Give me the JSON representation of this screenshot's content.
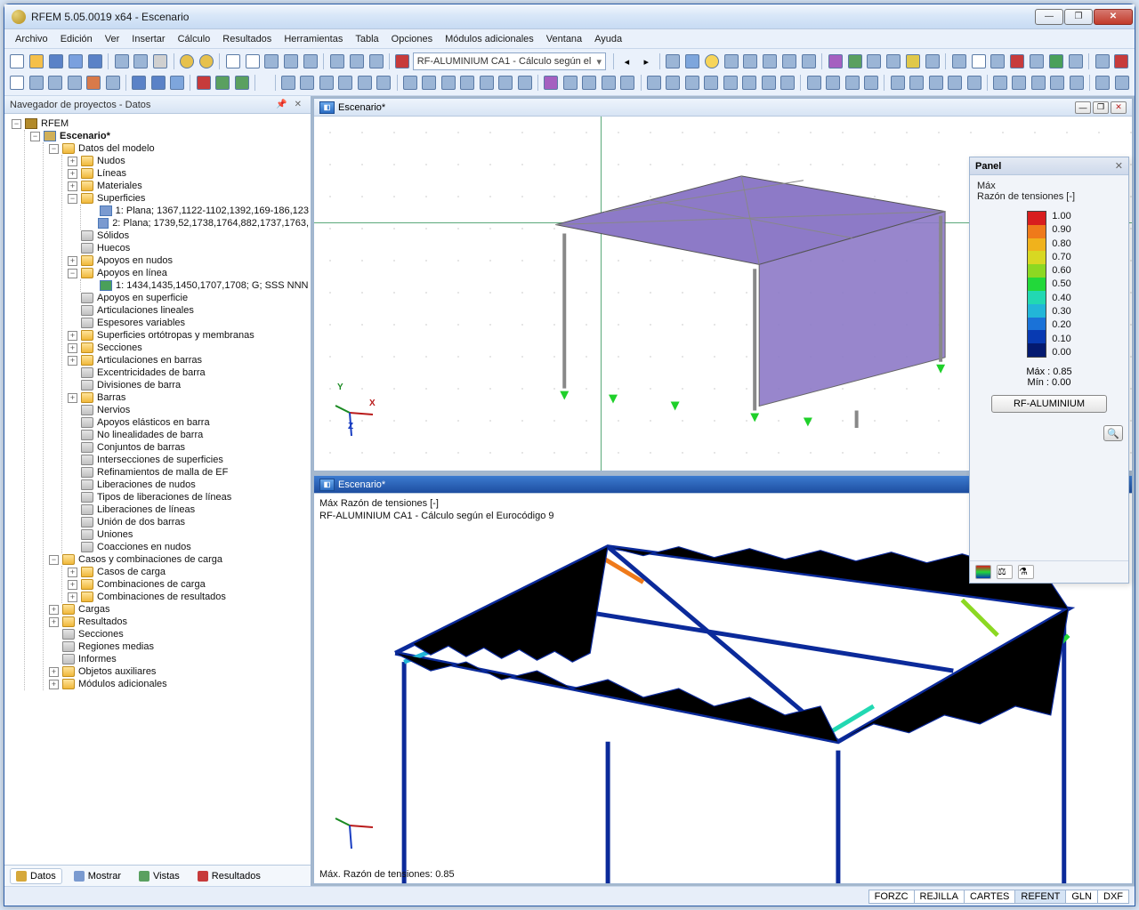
{
  "window": {
    "title": "RFEM 5.05.0019 x64 - Escenario"
  },
  "menu": [
    "Archivo",
    "Edición",
    "Ver",
    "Insertar",
    "Cálculo",
    "Resultados",
    "Herramientas",
    "Tabla",
    "Opciones",
    "Módulos adicionales",
    "Ventana",
    "Ayuda"
  ],
  "toolbar": {
    "module_field": "RF-ALUMINIUM CA1 - Cálculo según el"
  },
  "navigator": {
    "title": "Navegador de proyectos - Datos",
    "root": "RFEM",
    "model": "Escenario*",
    "groups": {
      "model_data": "Datos del modelo",
      "nodes": "Nudos",
      "lines": "Líneas",
      "materials": "Materiales",
      "surfaces": "Superficies",
      "surface1": "1: Plana; 1367,1122-1102,1392,169-186,123",
      "surface2": "2: Plana; 1739,52,1738,1764,882,1737,1763,",
      "solids": "Sólidos",
      "openings": "Huecos",
      "nodal_supports": "Apoyos en nudos",
      "line_supports": "Apoyos en línea",
      "line_support1": "1: 1434,1435,1450,1707,1708; G; SSS NNN",
      "surface_supports": "Apoyos en superficie",
      "line_hinges": "Articulaciones lineales",
      "var_thickness": "Espesores variables",
      "ortho": "Superficies ortótropas y membranas",
      "sections": "Secciones",
      "member_hinges": "Articulaciones en barras",
      "eccentricities": "Excentricidades de barra",
      "divisions": "Divisiones de barra",
      "members": "Barras",
      "ribs": "Nervios",
      "elastic": "Apoyos elásticos en barra",
      "nonlin": "No linealidades de barra",
      "sets": "Conjuntos de barras",
      "intersections": "Intersecciones de superficies",
      "mesh_refine": "Refinamientos de malla de EF",
      "node_releases": "Liberaciones de nudos",
      "line_release_types": "Tipos de liberaciones de líneas",
      "line_releases": "Liberaciones de líneas",
      "joints": "Unión de dos barras",
      "connections": "Uniones",
      "nodal_constraints": "Coacciones en nudos",
      "load_cases": "Casos y combinaciones de carga",
      "lc": "Casos de carga",
      "combos": "Combinaciones de carga",
      "result_combos": "Combinaciones de resultados",
      "loads": "Cargas",
      "results": "Resultados",
      "sections2": "Secciones",
      "avg_regions": "Regiones medias",
      "reports": "Informes",
      "aux": "Objetos auxiliares",
      "addons": "Módulos adicionales"
    },
    "tabs": {
      "data": "Datos",
      "show": "Mostrar",
      "views": "Vistas",
      "results": "Resultados"
    }
  },
  "views": {
    "upper_title": "Escenario*",
    "lower_title": "Escenario*",
    "lower_info1": "Máx Razón de tensiones [-]",
    "lower_info2": "RF-ALUMINIUM CA1 - Cálculo según el Eurocódigo 9",
    "lower_footer": "Máx. Razón de tensiones: 0.85"
  },
  "panel": {
    "title": "Panel",
    "max_label": "Máx",
    "ratio_label": "Razón de tensiones [-]",
    "colors": [
      "#d81e1e",
      "#ef7a1a",
      "#f0b21c",
      "#d8d822",
      "#8cd822",
      "#22d83a",
      "#22d8b2",
      "#22b6d8",
      "#1a72d8",
      "#083ab2",
      "#041a70"
    ],
    "values": [
      "1.00",
      "0.90",
      "0.80",
      "0.70",
      "0.60",
      "0.50",
      "0.40",
      "0.30",
      "0.20",
      "0.10",
      "0.00"
    ],
    "stat_max": "Máx  :  0.85",
    "stat_min": "Mín  :  0.00",
    "module_btn": "RF-ALUMINIUM"
  },
  "status": {
    "cells": [
      "FORZC",
      "REJILLA",
      "CARTES",
      "REFENT",
      "GLN",
      "DXF"
    ]
  }
}
